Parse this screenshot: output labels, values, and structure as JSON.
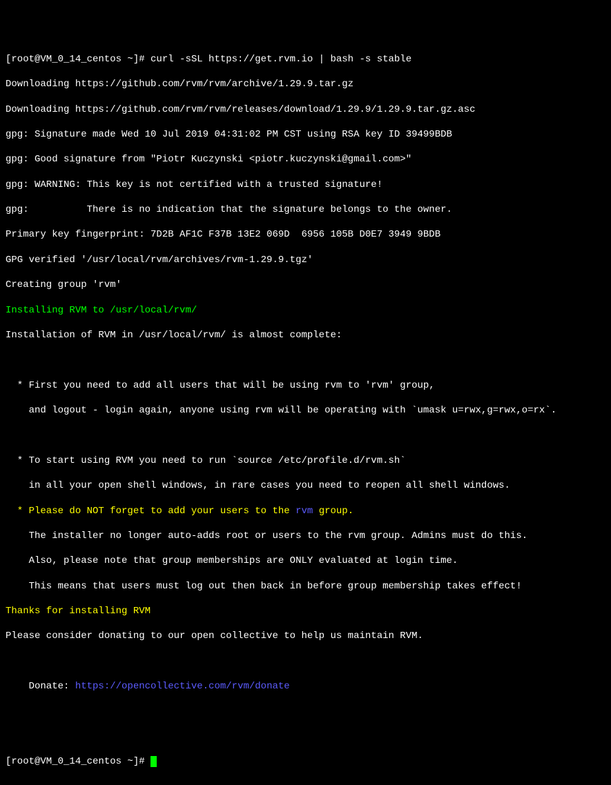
{
  "lines": {
    "prompt1": "[root@VM_0_14_centos ~]# curl -sSL https://get.rvm.io | bash -s stable",
    "download1": "Downloading https://github.com/rvm/rvm/archive/1.29.9.tar.gz",
    "download2": "Downloading https://github.com/rvm/rvm/releases/download/1.29.9/1.29.9.tar.gz.asc",
    "gpg1": "gpg: Signature made Wed 10 Jul 2019 04:31:02 PM CST using RSA key ID 39499BDB",
    "gpg2": "gpg: Good signature from \"Piotr Kuczynski <piotr.kuczynski@gmail.com>\"",
    "gpg3": "gpg: WARNING: This key is not certified with a trusted signature!",
    "gpg4": "gpg:          There is no indication that the signature belongs to the owner.",
    "fingerprint": "Primary key fingerprint: 7D2B AF1C F37B 13E2 069D  6956 105B D0E7 3949 9BDB",
    "verified": "GPG verified '/usr/local/rvm/archives/rvm-1.29.9.tgz'",
    "creating": "Creating group 'rvm'",
    "installing": "Installing RVM to /usr/local/rvm/",
    "almost": "Installation of RVM in /usr/local/rvm/ is almost complete:",
    "bullet1": "  * First you need to add all users that will be using rvm to 'rvm' group,",
    "bullet1b": "    and logout - login again, anyone using rvm will be operating with `umask u=rwx,g=rwx,o=rx`.",
    "bullet2": "  * To start using RVM you need to run `source /etc/profile.d/rvm.sh`",
    "bullet2b": "    in all your open shell windows, in rare cases you need to reopen all shell windows.",
    "bullet3prefix": "  * Please do NOT forget to add your users to the ",
    "bullet3rvm": "rvm",
    "bullet3suffix": " group.",
    "bullet3b": "    The installer no longer auto-adds root or users to the rvm group. Admins must do this.",
    "bullet3c": "    Also, please note that group memberships are ONLY evaluated at login time.",
    "bullet3d": "    This means that users must log out then back in before group membership takes effect!",
    "thanks": "Thanks for installing RVM",
    "donate": "Please consider donating to our open collective to help us maintain RVM.",
    "donatelabel": "    Donate: ",
    "donateurl": "https://opencollective.com/rvm/donate",
    "prompt2": "[root@VM_0_14_centos ~]# "
  }
}
